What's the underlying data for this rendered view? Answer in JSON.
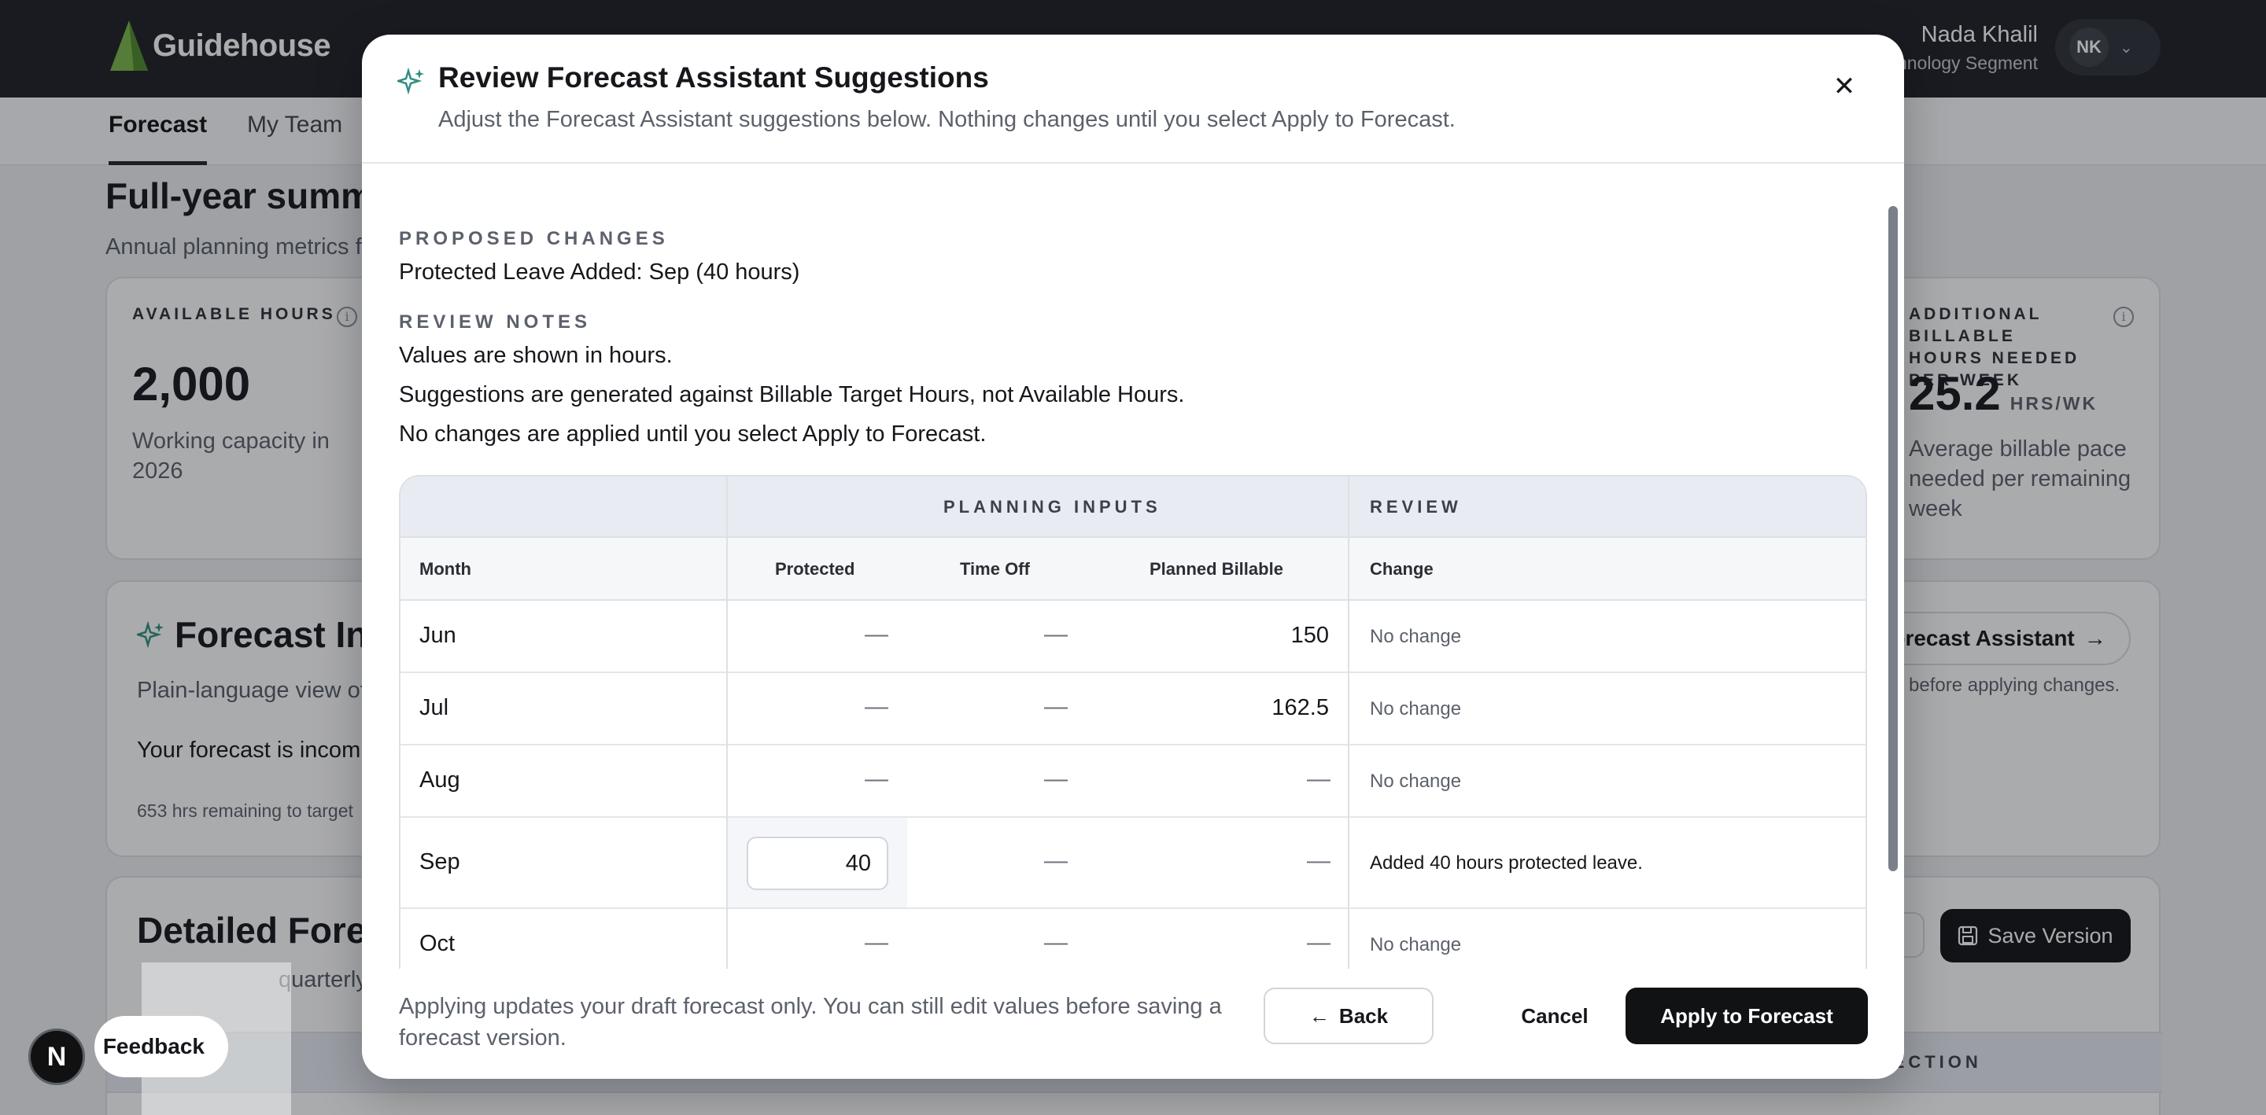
{
  "app": {
    "brand": "Guidehouse",
    "user_name": "Nada Khalil",
    "user_segment": "Technology Segment",
    "user_initials": "NK"
  },
  "nav": {
    "tabs": [
      {
        "label": "Forecast",
        "active": true
      },
      {
        "label": "My Team",
        "active": false
      }
    ]
  },
  "page": {
    "title": "Full-year summary",
    "subtitle": "Annual planning metrics for",
    "metrics": [
      {
        "label": "AVAILABLE HOURS",
        "value": "2,000",
        "description": "Working capacity in 2026"
      },
      {
        "label": "ADDITIONAL BILLABLE HOURS NEEDED PER WEEK",
        "value": "25.2",
        "unit": "HRS/WK",
        "description": "Average billable pace needed per remaining week"
      }
    ],
    "insights": {
      "title": "Forecast Insights",
      "subtitle": "Plain-language view of",
      "status": "Your forecast is incomplete",
      "remaining": "653 hrs remaining to target",
      "assistant_button": "Forecast Assistant",
      "assistant_note": "before applying changes."
    },
    "detailed": {
      "title": "Detailed Forecast",
      "subtitle": "quarterly",
      "save_version": "Save Version",
      "section_header": "SECTION"
    }
  },
  "feedback": {
    "label": "Feedback",
    "badge": "N"
  },
  "modal": {
    "title": "Review Forecast Assistant Suggestions",
    "subtitle": "Adjust the Forecast Assistant suggestions below. Nothing changes until you select Apply to Forecast.",
    "proposed": {
      "label": "PROPOSED CHANGES",
      "key": "Protected Leave Added:",
      "value": "Sep (40 hours)"
    },
    "notes": {
      "label": "REVIEW NOTES",
      "lines": [
        "Values are shown in hours.",
        "Suggestions are generated against Billable Target Hours, not Available Hours.",
        "No changes are applied until you select Apply to Forecast."
      ]
    },
    "table": {
      "groups": {
        "planning": "PLANNING INPUTS",
        "review": "REVIEW"
      },
      "columns": {
        "month": "Month",
        "protected": "Protected",
        "time_off": "Time Off",
        "planned_billable": "Planned Billable",
        "change": "Change"
      },
      "rows": [
        {
          "month": "Jun",
          "protected": "—",
          "time_off": "—",
          "planned_billable": "150",
          "change": "No change"
        },
        {
          "month": "Jul",
          "protected": "—",
          "time_off": "—",
          "planned_billable": "162.5",
          "change": "No change"
        },
        {
          "month": "Aug",
          "protected": "—",
          "time_off": "—",
          "planned_billable": "—",
          "change": "No change"
        },
        {
          "month": "Sep",
          "protected": "40",
          "time_off": "—",
          "planned_billable": "—",
          "change": "Added 40 hours protected leave."
        },
        {
          "month": "Oct",
          "protected": "—",
          "time_off": "—",
          "planned_billable": "—",
          "change": "No change"
        }
      ]
    },
    "footer": {
      "note": "Applying updates your draft forecast only. You can still edit values before saving a forecast version.",
      "back": "Back",
      "cancel": "Cancel",
      "apply": "Apply to Forecast"
    }
  }
}
